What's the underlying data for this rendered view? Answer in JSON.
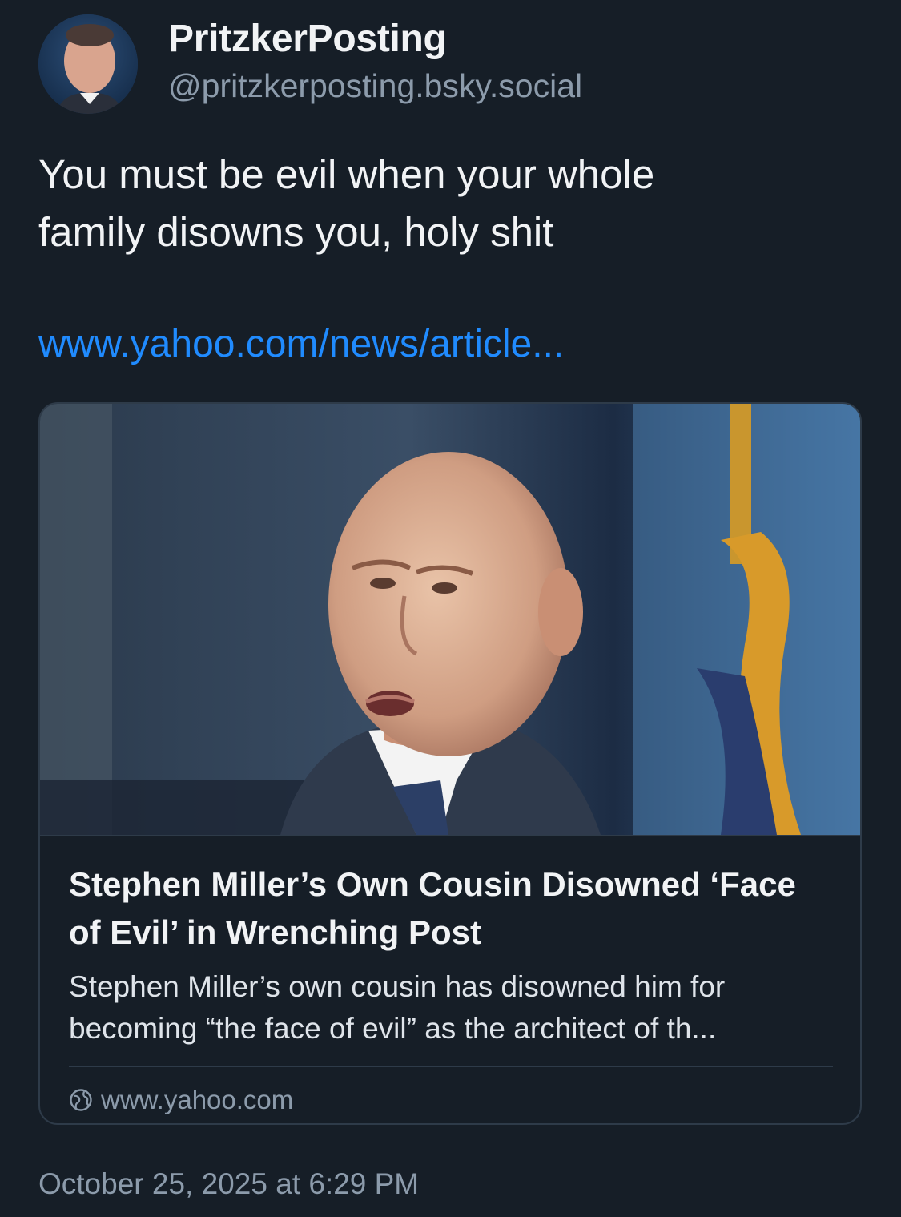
{
  "author": {
    "display_name": "PritzkerPosting",
    "handle": "@pritzkerposting.bsky.social"
  },
  "post": {
    "text": "You must be evil when your whole\nfamily disowns you, holy shit",
    "link_text": "www.yahoo.com/news/article...",
    "timestamp": "October 25, 2025 at 6:29 PM"
  },
  "link_card": {
    "title": "Stephen Miller’s Own Cousin Disowned ‘Face of Evil’ in Wrenching Post",
    "description": "Stephen Miller’s own cousin has disowned him for becoming “the face of evil” as the architect of th...",
    "domain": "www.yahoo.com"
  },
  "colors": {
    "background": "#161e27",
    "link": "#208bfe",
    "muted": "#8c9bab",
    "border": "#2e3b49"
  },
  "icons": {
    "card_domain_icon": "globe-icon"
  }
}
